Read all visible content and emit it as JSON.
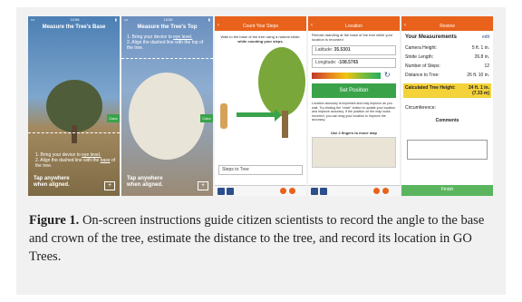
{
  "screens": {
    "base": {
      "title": "Measure the Tree's Base",
      "steps": [
        "1.  Bring your device to",
        "eye level.",
        "2.  Align the dashed line with the",
        "base",
        "of the tree."
      ],
      "tap": [
        "Tap anywhere",
        "when aligned."
      ],
      "color_label": "Color",
      "plus": "+"
    },
    "top": {
      "title": "Measure the Tree's Top",
      "steps": [
        "1.  Bring your device to",
        "eye level.",
        "2.  Align the dashed line with the top",
        "of the tree."
      ],
      "tap": [
        "Tap anywhere",
        "when aligned."
      ],
      "color_label": "Color",
      "plus": "+"
    },
    "steps": {
      "header": "Count Your Steps",
      "instruction": "Walk to the base of the tree using a natural stride,",
      "instruction_bold": "while counting your steps.",
      "field_placeholder": "Steps to Tree"
    },
    "location": {
      "header": "Location",
      "instruction": "Remain standing at the base of the tree while your location is recorded",
      "latitude_label": "Latitude:",
      "latitude_value": "35.5301",
      "longitude_label": "Longitude:",
      "longitude_value": "-108.5765",
      "set_button": "Set Position",
      "note": "Location accuracy is important and may improve as you wait. Try clicking the \"reset\" button to update your location and improve accuracy. If the position on the map looks incorrect, you can drag your location to improve the accuracy.",
      "map_hint": "Use 2 fingers to move map"
    },
    "review": {
      "header": "Review",
      "your_measurements": "Your Measurements",
      "edit": "edit",
      "rows": [
        {
          "label": "Camera Height:",
          "value": "5 ft. 1 in."
        },
        {
          "label": "Stride Length:",
          "value": "26.8 in."
        },
        {
          "label": "Number of Steps:",
          "value": "12"
        },
        {
          "label": "Distance to Tree:",
          "value": "26 ft. 10 in."
        }
      ],
      "calc_label": "Calculated Tree Height:",
      "calc_value": "24 ft. 1 in.",
      "calc_value_m": "(7.33 m)",
      "circumference_label": "Circumference:",
      "comments_label": "Comments",
      "finish": "Finish"
    }
  },
  "caption": {
    "label": "Figure 1.",
    "text": " On-screen instructions guide citizen scientists to record the angle to the base and crown of the tree, estimate the distance to the tree, and record its location in GO Trees."
  },
  "colors": {
    "orange": "#e8621c",
    "green": "#3aa34a",
    "yellow": "#f4d23a"
  }
}
